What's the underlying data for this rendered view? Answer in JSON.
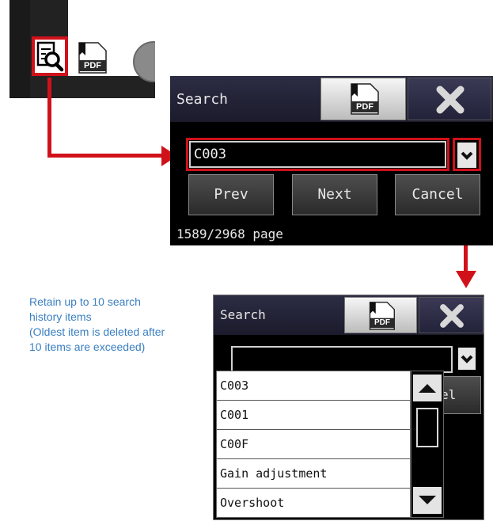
{
  "toolbar": {
    "search_tool_icon": "search-document-icon",
    "pdf_tool_label": "PDF"
  },
  "dialog_main": {
    "title": "Search",
    "pdf_label": "PDF",
    "close_icon": "close-x-icon",
    "search_value": "C003",
    "buttons": {
      "prev": "Prev",
      "next": "Next",
      "cancel": "Cancel"
    },
    "page_info": "1589/2968 page"
  },
  "note": {
    "lines": [
      "Retain up to 10 search",
      "history items",
      "(Oldest item is deleted after",
      "10 items are exceeded)"
    ]
  },
  "dialog_history": {
    "title": "Search",
    "pdf_label": "PDF",
    "close_icon": "close-x-icon",
    "cancel_partial": "el",
    "items": [
      "C003",
      "C001",
      "C00F",
      "Gain adjustment",
      "Overshoot"
    ]
  },
  "colors": {
    "highlight": "#d0111a",
    "note_text": "#3a7fc1",
    "titlebar": "#22223a"
  }
}
